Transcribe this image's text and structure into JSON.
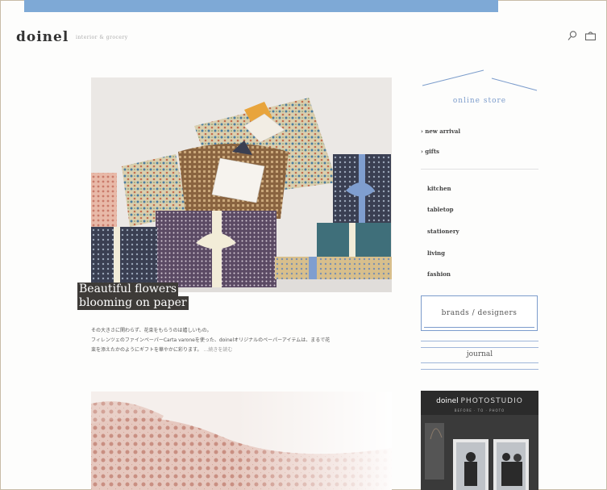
{
  "header": {
    "logo": "doinel",
    "tagline": "interior & grocery"
  },
  "colors": {
    "top_bar": "#7ea9d6",
    "accent": "#7c9ccc"
  },
  "icons": [
    "search-icon",
    "cart-icon",
    "chevron-right-icon"
  ],
  "post1": {
    "caption_line1": "Beautiful flowers",
    "caption_line2": "blooming on paper",
    "excerpt_line1": "その大きさに関わらず、花束をもらうのは嬉しいもの。",
    "excerpt_line2": "フィレンツェのファインペーパーCarta varoneを使った、doinelオリジナルのペーパーアイテムは、まるで花",
    "excerpt_line3": "束を添えたかのようにギフトを華やかに彩ります。",
    "read_more": "…続きを読む"
  },
  "sidebar": {
    "store_title": "online store",
    "arrow_items": [
      {
        "label": "new arrival"
      },
      {
        "label": "gifts"
      }
    ],
    "categories": [
      {
        "label": "kitchen"
      },
      {
        "label": "tabletop"
      },
      {
        "label": "stationery"
      },
      {
        "label": "living"
      },
      {
        "label": "fashion"
      }
    ],
    "brands_label": "brands / designers",
    "journal_label": "journal",
    "studio": {
      "title_part1": "doinel",
      "title_part2": "PHOTOSTUDIO",
      "subtitle": "BEFORE · TO · PHOTO"
    }
  }
}
